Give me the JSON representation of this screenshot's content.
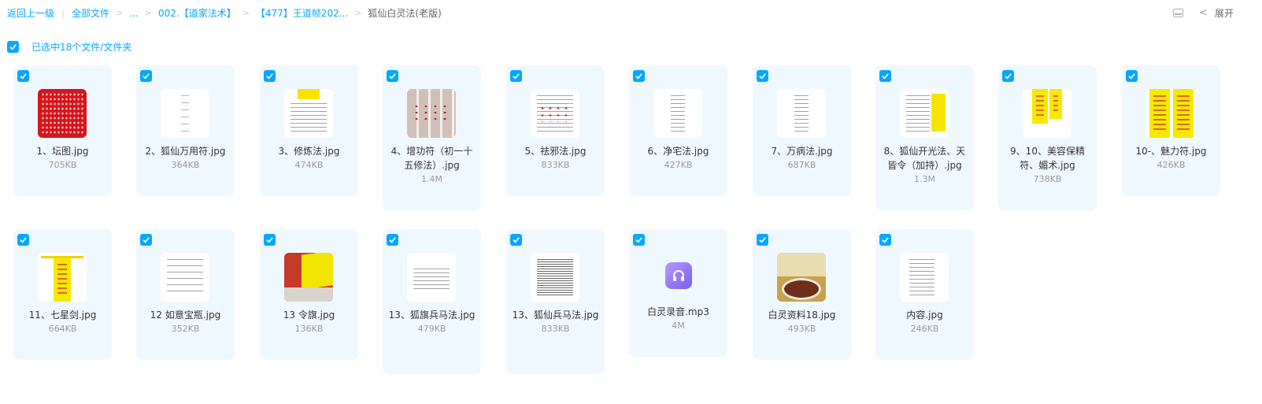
{
  "breadcrumb": {
    "back": "返回上一级",
    "all_files": "全部文件",
    "ellipsis": "...",
    "level1": "002.【道家法术】",
    "level2": "【477】王道帧202...",
    "current": "狐仙白灵法(老版)"
  },
  "toolbar": {
    "expand_label": "展开"
  },
  "selection": {
    "label": "已选中18个文件/文件夹"
  },
  "files": [
    {
      "name": "1、坛图.jpg",
      "size": "705KB",
      "thumb": "red-talisman"
    },
    {
      "name": "2、狐仙万用符.jpg",
      "size": "364KB",
      "thumb": "sparse-document"
    },
    {
      "name": "3、修炼法.jpg",
      "size": "474KB",
      "thumb": "document-with-yellow-tag"
    },
    {
      "name": "4、增功符（初一十五修法）.jpg",
      "size": "1.4M",
      "thumb": "talisman-scrolls"
    },
    {
      "name": "5、祛邪法.jpg",
      "size": "833KB",
      "thumb": "document-with-red-marks"
    },
    {
      "name": "6、净宅法.jpg",
      "size": "427KB",
      "thumb": "centered-document"
    },
    {
      "name": "7、万病法.jpg",
      "size": "687KB",
      "thumb": "centered-document"
    },
    {
      "name": "8、狐仙开光法、天皆令（加持）.jpg",
      "size": "1.3M",
      "thumb": "document-with-yellow-side"
    },
    {
      "name": "9、10、美容保精符、媚术.jpg",
      "size": "738KB",
      "thumb": "yellow-talismans"
    },
    {
      "name": "10-、魅力符.jpg",
      "size": "426KB",
      "thumb": "yellow-talismans"
    },
    {
      "name": "11、七星剑.jpg",
      "size": "664KB",
      "thumb": "yellow-talisman-single"
    },
    {
      "name": "12 如意宝瓶.jpg",
      "size": "352KB",
      "thumb": "document"
    },
    {
      "name": "13 令旗.jpg",
      "size": "136KB",
      "thumb": "flag-photo"
    },
    {
      "name": "13、狐旗兵马法.jpg",
      "size": "479KB",
      "thumb": "document"
    },
    {
      "name": "13、狐仙兵马法.jpg",
      "size": "833KB",
      "thumb": "document"
    },
    {
      "name": "白灵录音.mp3",
      "size": "4M",
      "thumb": "audio-icon"
    },
    {
      "name": "白灵资料18.jpg",
      "size": "493KB",
      "thumb": "food-photo"
    },
    {
      "name": "内容.jpg",
      "size": "246KB",
      "thumb": "centered-document"
    }
  ]
}
